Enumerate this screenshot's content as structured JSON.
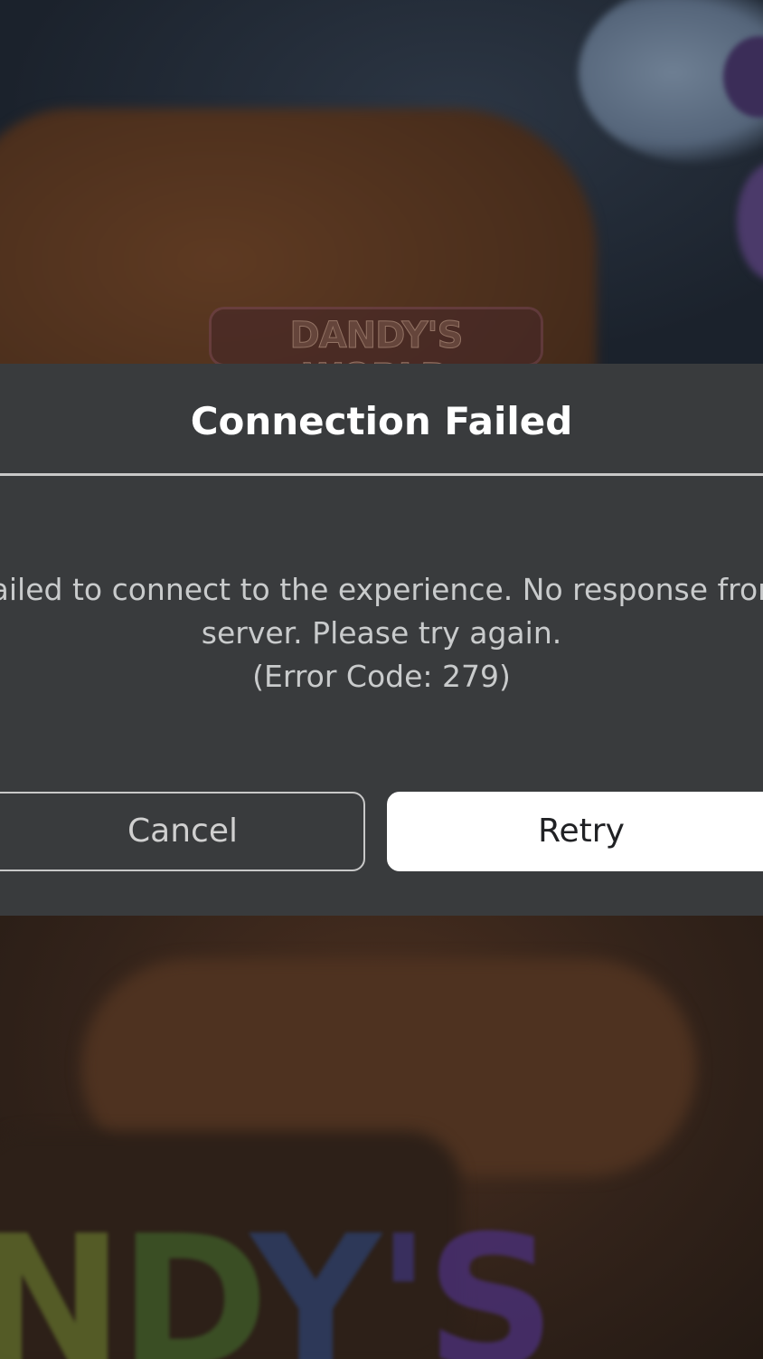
{
  "background": {
    "logo_text": "DANDY'S WORLD",
    "bottom_letters": [
      "N",
      "D",
      "Y",
      "'",
      "S"
    ]
  },
  "dialog": {
    "title": "Connection Failed",
    "message_lines": [
      "Failed to connect to the experience. No response from",
      "server. Please try again.",
      "(Error Code: 279)"
    ],
    "cancel_label": "Cancel",
    "retry_label": "Retry"
  },
  "colors": {
    "dialog_background": "#393b3d",
    "title_text": "#ffffff",
    "message_text": "#c9cbcc",
    "retry_button_background": "#ffffff",
    "cancel_button_border": "#c8c8c8"
  }
}
